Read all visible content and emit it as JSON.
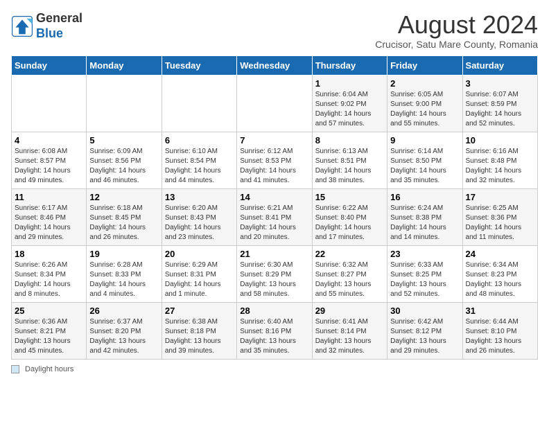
{
  "header": {
    "logo_general": "General",
    "logo_blue": "Blue",
    "title": "August 2024",
    "subtitle": "Crucisor, Satu Mare County, Romania"
  },
  "days_of_week": [
    "Sunday",
    "Monday",
    "Tuesday",
    "Wednesday",
    "Thursday",
    "Friday",
    "Saturday"
  ],
  "legend_label": "Daylight hours",
  "weeks": [
    [
      {
        "day": "",
        "info": ""
      },
      {
        "day": "",
        "info": ""
      },
      {
        "day": "",
        "info": ""
      },
      {
        "day": "",
        "info": ""
      },
      {
        "day": "1",
        "info": "Sunrise: 6:04 AM\nSunset: 9:02 PM\nDaylight: 14 hours and 57 minutes."
      },
      {
        "day": "2",
        "info": "Sunrise: 6:05 AM\nSunset: 9:00 PM\nDaylight: 14 hours and 55 minutes."
      },
      {
        "day": "3",
        "info": "Sunrise: 6:07 AM\nSunset: 8:59 PM\nDaylight: 14 hours and 52 minutes."
      }
    ],
    [
      {
        "day": "4",
        "info": "Sunrise: 6:08 AM\nSunset: 8:57 PM\nDaylight: 14 hours and 49 minutes."
      },
      {
        "day": "5",
        "info": "Sunrise: 6:09 AM\nSunset: 8:56 PM\nDaylight: 14 hours and 46 minutes."
      },
      {
        "day": "6",
        "info": "Sunrise: 6:10 AM\nSunset: 8:54 PM\nDaylight: 14 hours and 44 minutes."
      },
      {
        "day": "7",
        "info": "Sunrise: 6:12 AM\nSunset: 8:53 PM\nDaylight: 14 hours and 41 minutes."
      },
      {
        "day": "8",
        "info": "Sunrise: 6:13 AM\nSunset: 8:51 PM\nDaylight: 14 hours and 38 minutes."
      },
      {
        "day": "9",
        "info": "Sunrise: 6:14 AM\nSunset: 8:50 PM\nDaylight: 14 hours and 35 minutes."
      },
      {
        "day": "10",
        "info": "Sunrise: 6:16 AM\nSunset: 8:48 PM\nDaylight: 14 hours and 32 minutes."
      }
    ],
    [
      {
        "day": "11",
        "info": "Sunrise: 6:17 AM\nSunset: 8:46 PM\nDaylight: 14 hours and 29 minutes."
      },
      {
        "day": "12",
        "info": "Sunrise: 6:18 AM\nSunset: 8:45 PM\nDaylight: 14 hours and 26 minutes."
      },
      {
        "day": "13",
        "info": "Sunrise: 6:20 AM\nSunset: 8:43 PM\nDaylight: 14 hours and 23 minutes."
      },
      {
        "day": "14",
        "info": "Sunrise: 6:21 AM\nSunset: 8:41 PM\nDaylight: 14 hours and 20 minutes."
      },
      {
        "day": "15",
        "info": "Sunrise: 6:22 AM\nSunset: 8:40 PM\nDaylight: 14 hours and 17 minutes."
      },
      {
        "day": "16",
        "info": "Sunrise: 6:24 AM\nSunset: 8:38 PM\nDaylight: 14 hours and 14 minutes."
      },
      {
        "day": "17",
        "info": "Sunrise: 6:25 AM\nSunset: 8:36 PM\nDaylight: 14 hours and 11 minutes."
      }
    ],
    [
      {
        "day": "18",
        "info": "Sunrise: 6:26 AM\nSunset: 8:34 PM\nDaylight: 14 hours and 8 minutes."
      },
      {
        "day": "19",
        "info": "Sunrise: 6:28 AM\nSunset: 8:33 PM\nDaylight: 14 hours and 4 minutes."
      },
      {
        "day": "20",
        "info": "Sunrise: 6:29 AM\nSunset: 8:31 PM\nDaylight: 14 hours and 1 minute."
      },
      {
        "day": "21",
        "info": "Sunrise: 6:30 AM\nSunset: 8:29 PM\nDaylight: 13 hours and 58 minutes."
      },
      {
        "day": "22",
        "info": "Sunrise: 6:32 AM\nSunset: 8:27 PM\nDaylight: 13 hours and 55 minutes."
      },
      {
        "day": "23",
        "info": "Sunrise: 6:33 AM\nSunset: 8:25 PM\nDaylight: 13 hours and 52 minutes."
      },
      {
        "day": "24",
        "info": "Sunrise: 6:34 AM\nSunset: 8:23 PM\nDaylight: 13 hours and 48 minutes."
      }
    ],
    [
      {
        "day": "25",
        "info": "Sunrise: 6:36 AM\nSunset: 8:21 PM\nDaylight: 13 hours and 45 minutes."
      },
      {
        "day": "26",
        "info": "Sunrise: 6:37 AM\nSunset: 8:20 PM\nDaylight: 13 hours and 42 minutes."
      },
      {
        "day": "27",
        "info": "Sunrise: 6:38 AM\nSunset: 8:18 PM\nDaylight: 13 hours and 39 minutes."
      },
      {
        "day": "28",
        "info": "Sunrise: 6:40 AM\nSunset: 8:16 PM\nDaylight: 13 hours and 35 minutes."
      },
      {
        "day": "29",
        "info": "Sunrise: 6:41 AM\nSunset: 8:14 PM\nDaylight: 13 hours and 32 minutes."
      },
      {
        "day": "30",
        "info": "Sunrise: 6:42 AM\nSunset: 8:12 PM\nDaylight: 13 hours and 29 minutes."
      },
      {
        "day": "31",
        "info": "Sunrise: 6:44 AM\nSunset: 8:10 PM\nDaylight: 13 hours and 26 minutes."
      }
    ]
  ]
}
